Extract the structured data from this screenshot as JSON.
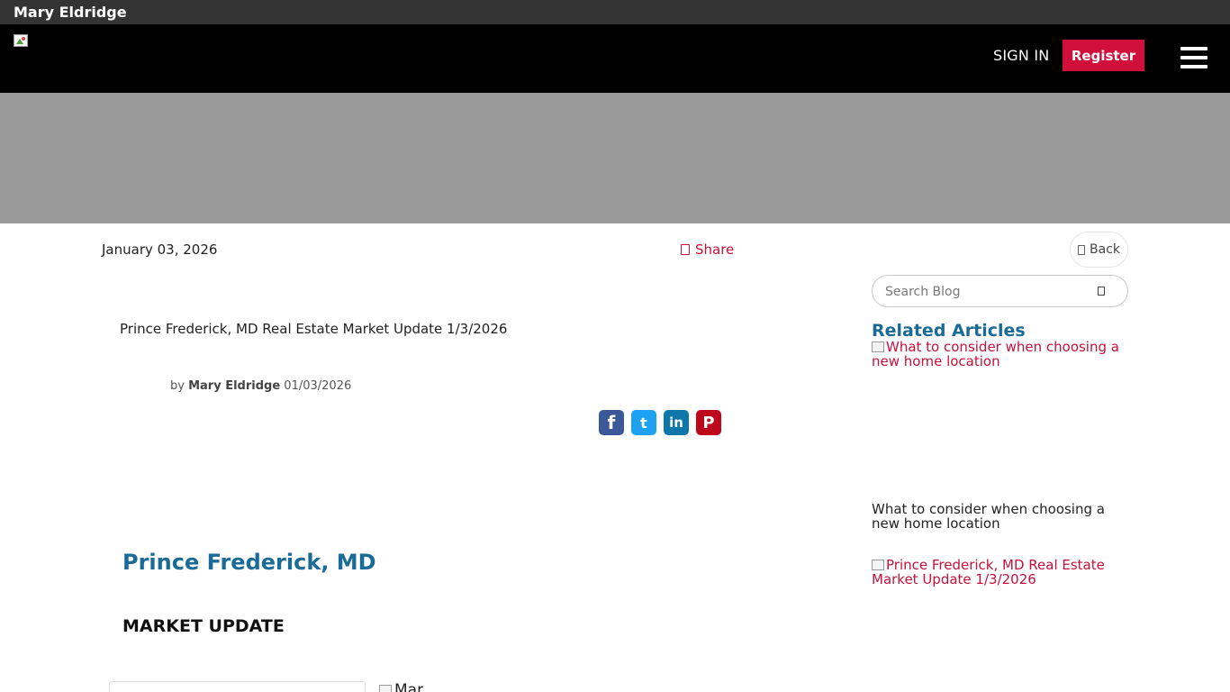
{
  "header": {
    "agent_name": "Mary Eldridge",
    "signin_label": "SIGN IN",
    "register_label": "Register",
    "logo_icon": "broken-image-icon",
    "menu_icon": "hamburger-icon",
    "colors": {
      "top_strip": "#333333",
      "nav_bg": "#000000",
      "accent": "#d0103a",
      "banner": "#999999"
    }
  },
  "toolbar": {
    "date": "January 03, 2026",
    "share_label": "Share",
    "share_icon": "share-icon",
    "back_label": "Back",
    "back_icon": "chevron-left-icon"
  },
  "sidebar": {
    "search_placeholder": "Search Blog",
    "search_icon": "search-icon",
    "related_title": "Related Articles",
    "related": [
      {
        "image_alt": "What to consider when choosing a new home location",
        "caption": "What to consider when choosing a new home location"
      },
      {
        "image_alt": "Prince Frederick, MD Real Estate Market Update 1/3/2026"
      }
    ]
  },
  "post": {
    "title": "Prince Frederick, MD Real Estate Market Update 1/3/2026",
    "by_label": "by",
    "author": "Mary Eldridge",
    "date": "01/03/2026",
    "social": [
      {
        "name": "facebook",
        "glyph": "f"
      },
      {
        "name": "twitter",
        "glyph": "t"
      },
      {
        "name": "linkedin",
        "glyph": "in"
      },
      {
        "name": "pinterest",
        "glyph": "P"
      }
    ],
    "social_colors": {
      "facebook": "#3b5998",
      "twitter": "#1da1f2",
      "linkedin": "#0e76a8",
      "pinterest": "#bd081c"
    },
    "city_heading": "Prince Frederick, MD",
    "market_heading": "MARKET UPDATE",
    "market_image_alt": "Mar..."
  }
}
